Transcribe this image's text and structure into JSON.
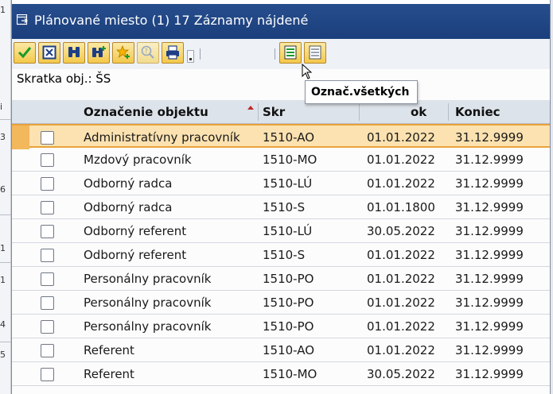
{
  "background": {
    "left_fragments": [
      "1",
      "i",
      "3",
      "6",
      "1",
      "1",
      "4",
      "5"
    ]
  },
  "window": {
    "title": "Plánované miesto (1)   17 Záznamy nájdené"
  },
  "toolbar": {
    "buttons": [
      {
        "name": "confirm-button",
        "icon": "check-icon"
      },
      {
        "name": "cancel-button",
        "icon": "x-box-icon"
      },
      {
        "name": "find-button",
        "icon": "binoculars-icon"
      },
      {
        "name": "find-next-button",
        "icon": "binoculars-plus-icon"
      },
      {
        "name": "new-entry-button",
        "icon": "star-plus-icon"
      },
      {
        "name": "information-button",
        "icon": "help-icon",
        "disabled": true
      },
      {
        "name": "print-button",
        "icon": "printer-icon"
      },
      {
        "name": "select-all-button",
        "icon": "select-all-icon"
      },
      {
        "name": "deselect-all-button",
        "icon": "deselect-all-icon"
      }
    ],
    "tooltip": "Označ.všetkých"
  },
  "filter_info": "Skratka obj.: ŠS",
  "grid": {
    "columns": [
      "Označenie objektu",
      "Skr",
      "ok",
      "Koniec"
    ],
    "rows": [
      {
        "name": "Administratívny pracovník",
        "abbr": "1510-AO",
        "start": "01.01.2022",
        "end": "31.12.9999"
      },
      {
        "name": "Mzdový pracovník",
        "abbr": "1510-MO",
        "start": "01.01.2022",
        "end": "31.12.9999"
      },
      {
        "name": "Odborný radca",
        "abbr": "1510-LÚ",
        "start": "01.01.2022",
        "end": "31.12.9999"
      },
      {
        "name": "Odborný radca",
        "abbr": "1510-S",
        "start": "01.01.1800",
        "end": "31.12.9999"
      },
      {
        "name": "Odborný referent",
        "abbr": "1510-LÚ",
        "start": "30.05.2022",
        "end": "31.12.9999"
      },
      {
        "name": "Odborný referent",
        "abbr": "1510-S",
        "start": "01.01.2022",
        "end": "31.12.9999"
      },
      {
        "name": "Personálny pracovník",
        "abbr": "1510-PO",
        "start": "01.01.2022",
        "end": "31.12.9999"
      },
      {
        "name": "Personálny pracovník",
        "abbr": "1510-PO",
        "start": "01.01.2022",
        "end": "31.12.9999"
      },
      {
        "name": "Personálny pracovník",
        "abbr": "1510-PO",
        "start": "01.01.2022",
        "end": "31.12.9999"
      },
      {
        "name": "Referent",
        "abbr": "1510-AO",
        "start": "01.01.2022",
        "end": "31.12.9999"
      },
      {
        "name": "Referent",
        "abbr": "1510-MO",
        "start": "30.05.2022",
        "end": "31.12.9999"
      }
    ],
    "selected_row": 0
  },
  "colors": {
    "titlebar": "#1f4684",
    "selection": "#fce2b0",
    "button_face": "#f3c94a"
  }
}
